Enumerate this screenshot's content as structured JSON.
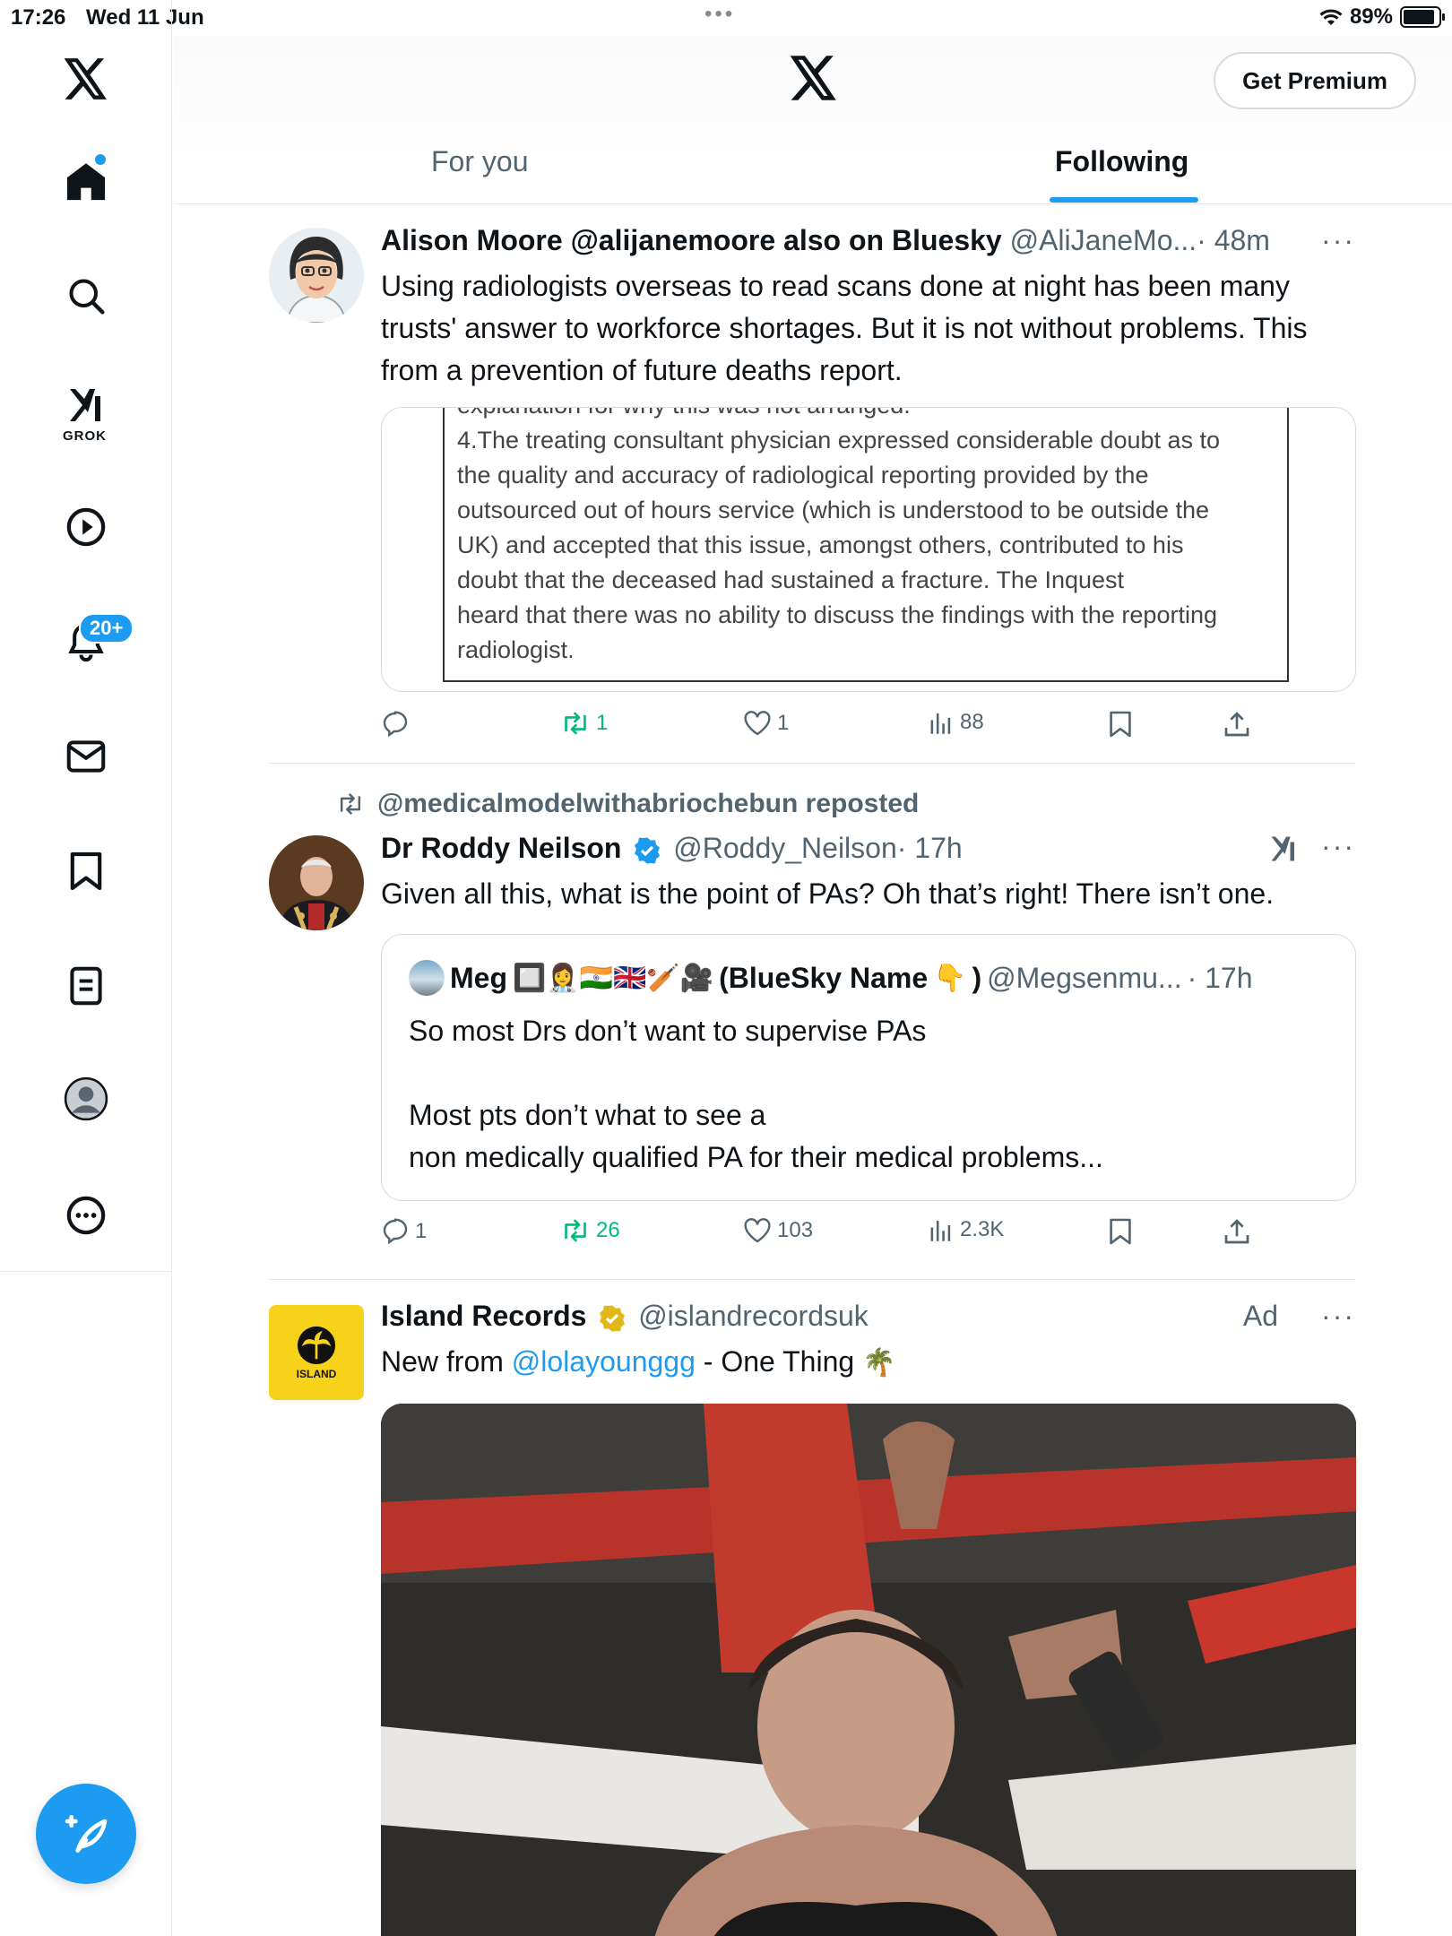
{
  "status_bar": {
    "time": "17:26",
    "date": "Wed 11 Jun",
    "battery": "89%",
    "battery_level": 0.89
  },
  "sidebar": {
    "items": [
      {
        "icon": "x-logo-icon"
      },
      {
        "icon": "home-icon"
      },
      {
        "icon": "search-icon"
      },
      {
        "icon": "grok-icon",
        "label": "GROK"
      },
      {
        "icon": "video-icon"
      },
      {
        "icon": "bell-icon",
        "badge": "20+"
      },
      {
        "icon": "mail-icon"
      },
      {
        "icon": "bookmark-icon"
      },
      {
        "icon": "lists-icon"
      },
      {
        "icon": "profile-icon"
      },
      {
        "icon": "more-circle-icon"
      }
    ],
    "compose_icon": "compose-icon"
  },
  "header": {
    "premium_label": "Get Premium",
    "tabs": [
      {
        "label": "For you"
      },
      {
        "label": "Following"
      }
    ],
    "active_tab": "Following"
  },
  "posts": [
    {
      "name": "Alison Moore @alijanemoore also on Bluesky",
      "handle": "@AliJaneMo...",
      "time": "· 48m",
      "text": "Using radiologists overseas to read scans done at night has been many trusts' answer to workforce shortages. But it is not without problems. This from a prevention of future deaths report.",
      "image_doc": {
        "clipped_line": "explanation for why this was not arranged.",
        "lines": [
          "4.The treating consultant physician expressed considerable doubt as to",
          "the quality and  accuracy of radiological reporting provided by the",
          "outsourced out of hours service (which is understood to be outside the",
          "UK)  and accepted that this issue, amongst others,  contributed to his",
          "doubt that the deceased had sustained a fracture. The Inquest",
          "heard that there was no ability to discuss the findings with the reporting",
          "radiologist."
        ]
      },
      "replies": "",
      "reposts": "1",
      "likes": "1",
      "views": "88"
    },
    {
      "repost_by": "@medicalmodelwithabriochebun reposted",
      "name": "Dr Roddy Neilson",
      "handle": "@Roddy_Neilson",
      "time": "· 17h",
      "text": "Given all this, what is the point of PAs? Oh that’s right! There isn’t one.",
      "quote": {
        "name": "Meg",
        "emojis": "🔲👩‍⚕️🇮🇳🇬🇧🏏🎥",
        "name_suffix": "(BlueSky Name",
        "name_suffix_emoji": "👇",
        "name_close": ")",
        "handle": "@Megsenmu...",
        "time": "· 17h",
        "text": "So most Drs don’t want to supervise PAs\n\nMost pts don’t what to see a\nnon medically qualified PA for their medical  problems..."
      },
      "replies": "1",
      "reposts": "26",
      "likes": "103",
      "views": "2.3K"
    },
    {
      "name": "Island Records",
      "handle": "@islandrecordsuk",
      "ad_label": "Ad",
      "text_prefix": "New from ",
      "mention": "@lolayounggg",
      "text_suffix": " - One Thing ",
      "text_emoji": "🌴",
      "avatar_text": "ISLAND"
    }
  ],
  "colors": {
    "accent": "#1d9bf0",
    "repost_green": "#00ba7c",
    "muted": "#536471",
    "gold_verified": "#e2b719"
  }
}
